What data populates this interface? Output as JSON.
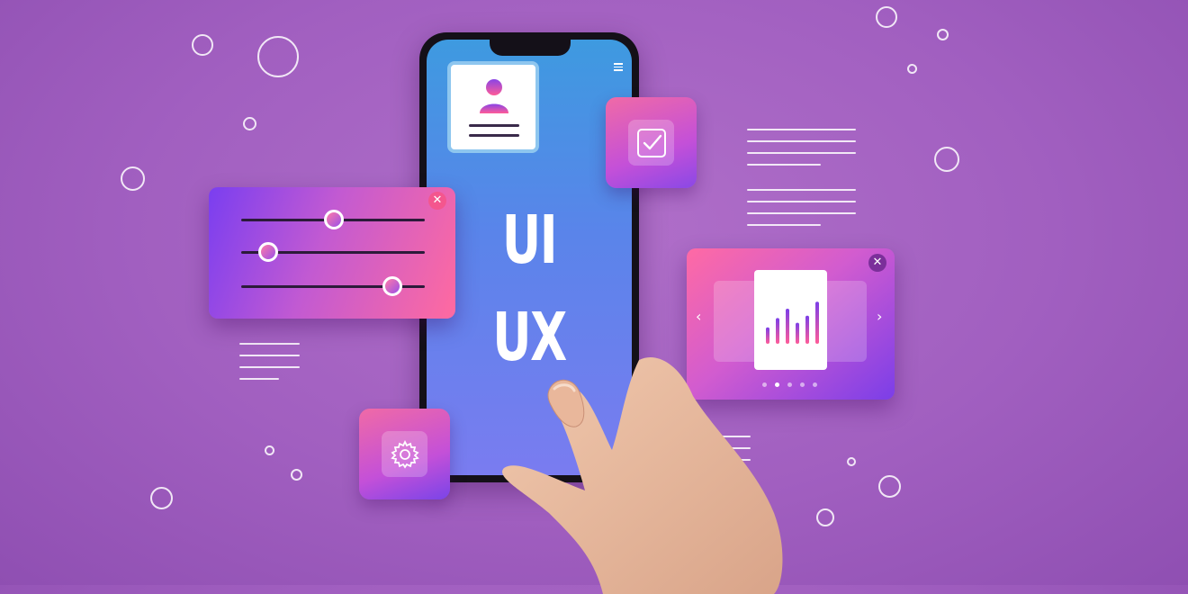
{
  "phone": {
    "line1": "UI",
    "line2": "UX"
  },
  "colors": {
    "background": "#a562c2",
    "accent_pink": "#f4568e",
    "accent_purple": "#7a3ef0",
    "screen_blue": "#3e9ae0"
  },
  "icons": {
    "profile": "user-icon",
    "check": "checkbox-icon",
    "gear": "gear-icon",
    "chart": "bar-chart-icon",
    "close": "close-icon",
    "prev": "chevron-left-icon",
    "next": "chevron-right-icon",
    "menu": "menu-icon"
  },
  "slider_panel": {
    "close_label": "✕",
    "sliders": [
      0.51,
      0.14,
      0.82
    ]
  },
  "carousel_panel": {
    "close_label": "✕",
    "prev_label": "‹",
    "next_label": "›",
    "page_count": 5,
    "active_page": 2,
    "chart_values": [
      0.35,
      0.55,
      0.75,
      0.45,
      0.6,
      0.9
    ]
  }
}
